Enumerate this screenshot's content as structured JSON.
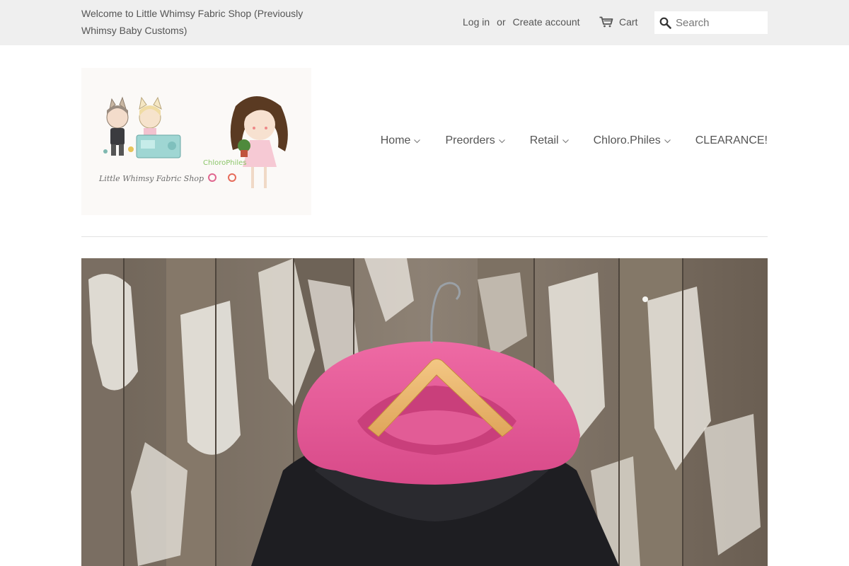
{
  "topbar": {
    "welcome_text": "Welcome to Little Whimsy Fabric Shop (Previously Whimsy Baby Customs)",
    "login_label": "Log in",
    "or_text": "or",
    "create_account_label": "Create account",
    "cart_label": "Cart",
    "cart_icon": "cart-icon",
    "search": {
      "placeholder": "Search",
      "value": "",
      "icon": "search-icon"
    }
  },
  "logo": {
    "shop_name": "Little Whimsy Fabric Shop",
    "secondary_name": "ChloroPhiles"
  },
  "nav": {
    "items": [
      {
        "label": "Home",
        "has_dropdown": true
      },
      {
        "label": "Preorders",
        "has_dropdown": true
      },
      {
        "label": "Retail",
        "has_dropdown": true
      },
      {
        "label": "Chloro.Philes",
        "has_dropdown": true
      },
      {
        "label": "CLEARANCE!",
        "has_dropdown": false
      }
    ]
  },
  "hero": {
    "image": "pink-hooded-black-sweatshirt-on-wooden-hanger-against-weathered-wood"
  },
  "colors": {
    "topbar_bg": "#efefef",
    "text": "#555555",
    "hood_pink": "#e85b98",
    "sweatshirt_black": "#1e1e22",
    "hanger_wood": "#e8b468"
  }
}
